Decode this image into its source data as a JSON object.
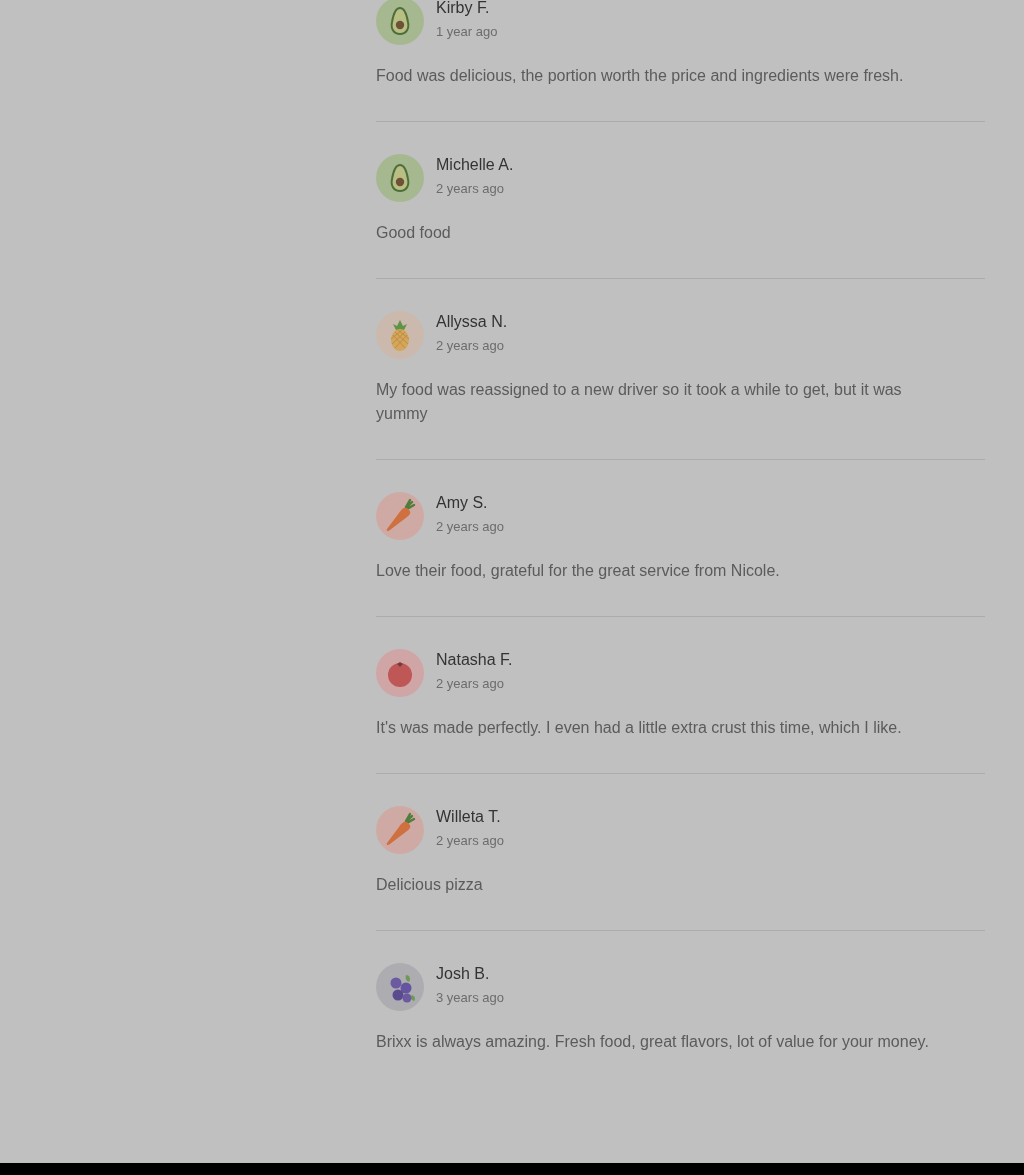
{
  "reviews": [
    {
      "name": "Kirby F.",
      "time": "1 year ago",
      "text": "Food was delicious, the portion worth the price and ingredients were fresh.",
      "avatar": {
        "kind": "avocado"
      }
    },
    {
      "name": "Michelle A.",
      "time": "2 years ago",
      "text": "Good food",
      "avatar": {
        "kind": "avocado"
      }
    },
    {
      "name": "Allyssa N.",
      "time": "2 years ago",
      "text": "My food was reassigned to a new driver so it took a while to get, but it was yummy",
      "avatar": {
        "kind": "pineapple"
      }
    },
    {
      "name": "Amy S.",
      "time": "2 years ago",
      "text": "Love their food, grateful for the great service from Nicole.",
      "avatar": {
        "kind": "carrot"
      }
    },
    {
      "name": "Natasha F.",
      "time": "2 years ago",
      "text": "It's was made perfectly. I even had a little extra crust this time, which I like.",
      "avatar": {
        "kind": "tomato"
      }
    },
    {
      "name": "Willeta T.",
      "time": "2 years ago",
      "text": "Delicious pizza",
      "avatar": {
        "kind": "carrot"
      }
    },
    {
      "name": "Josh B.",
      "time": "3 years ago",
      "text": "Brixx is always amazing. Fresh food, great flavors, lot of value for your money.",
      "avatar": {
        "kind": "blueberry"
      }
    }
  ]
}
